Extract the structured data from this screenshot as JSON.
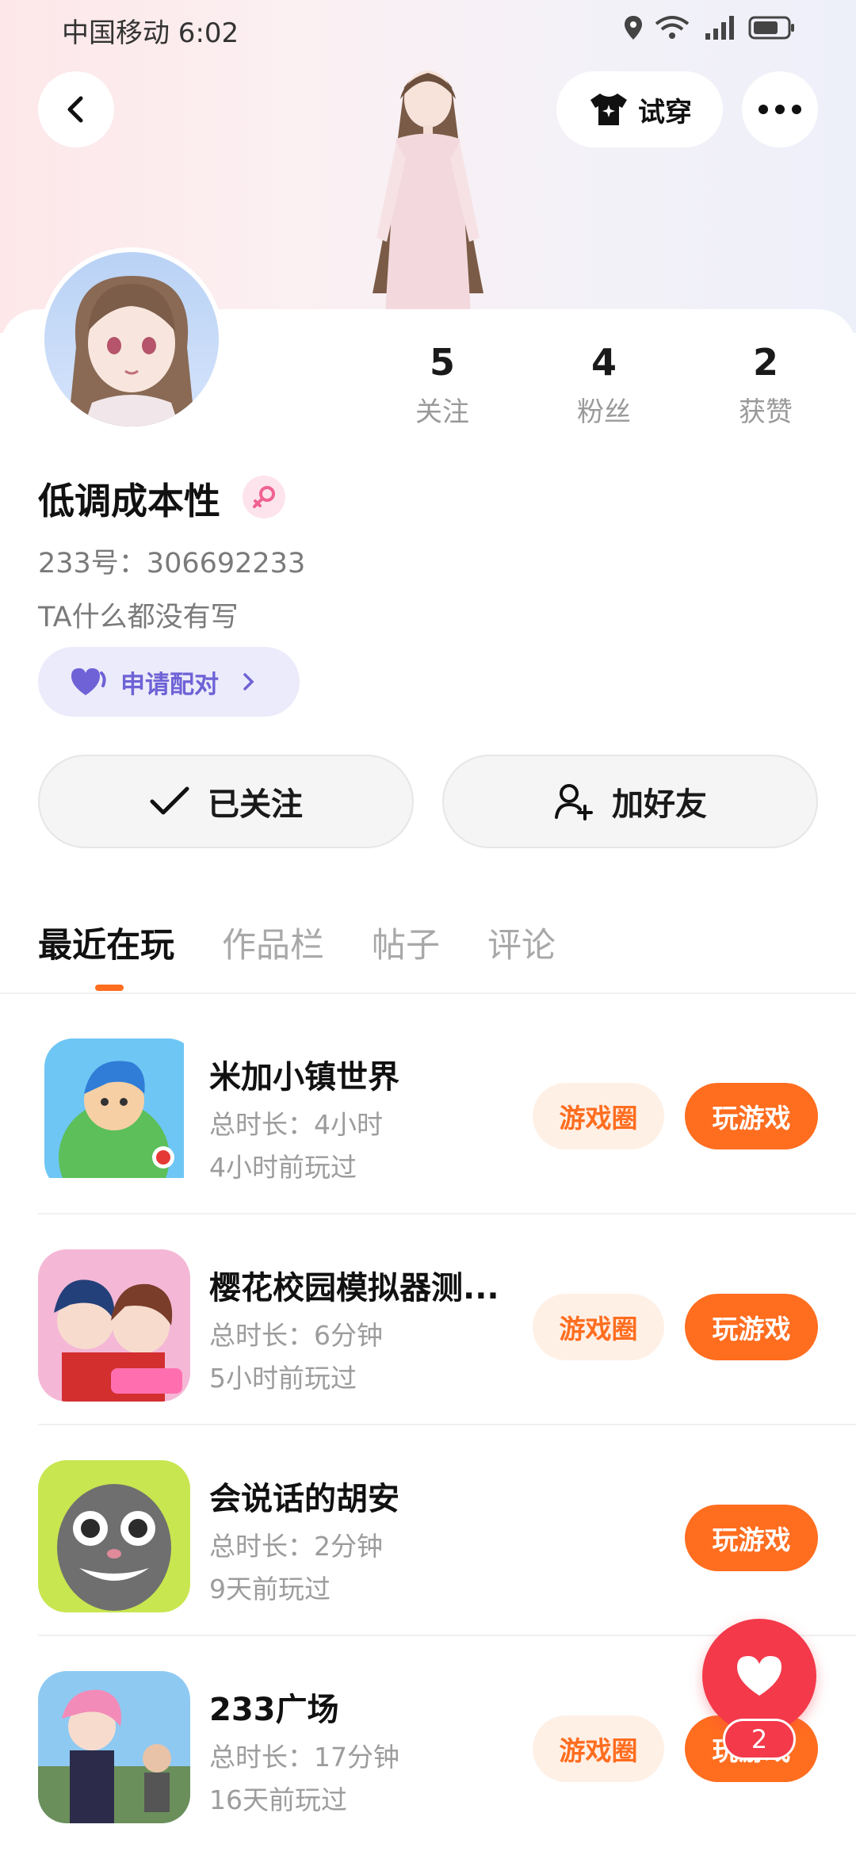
{
  "status_bar": {
    "carrier_time": "中国移动 6:02"
  },
  "header": {
    "tryon_label": "试穿"
  },
  "profile": {
    "name": "低调成本性",
    "uid": "233号：306692233",
    "bio": "TA什么都没有写",
    "pair_label": "申请配对",
    "stats": [
      {
        "value": "5",
        "label": "关注"
      },
      {
        "value": "4",
        "label": "粉丝"
      },
      {
        "value": "2",
        "label": "获赞"
      }
    ],
    "follow_label": "已关注",
    "add_friend_label": "加好友"
  },
  "tabs": [
    {
      "label": "最近在玩",
      "active": true
    },
    {
      "label": "作品栏",
      "active": false
    },
    {
      "label": "帖子",
      "active": false
    },
    {
      "label": "评论",
      "active": false
    }
  ],
  "games": [
    {
      "title": "米加小镇世界",
      "duration": "总时长：4小时",
      "last_played": "4小时前玩过",
      "circle_label": "游戏圈",
      "play_label": "玩游戏"
    },
    {
      "title": "樱花校园模拟器测...",
      "duration": "总时长：6分钟",
      "last_played": "5小时前玩过",
      "circle_label": "游戏圈",
      "play_label": "玩游戏"
    },
    {
      "title": "会说话的胡安",
      "duration": "总时长：2分钟",
      "last_played": "9天前玩过",
      "play_label": "玩游戏"
    },
    {
      "title": "233广场",
      "duration": "总时长：17分钟",
      "last_played": "16天前玩过",
      "circle_label": "游戏圈",
      "play_label": "玩游戏"
    }
  ],
  "fab": {
    "count": "2"
  },
  "colors": {
    "accent": "#ff6d1f",
    "like": "#f3394a",
    "pair": "#6e62d6"
  }
}
